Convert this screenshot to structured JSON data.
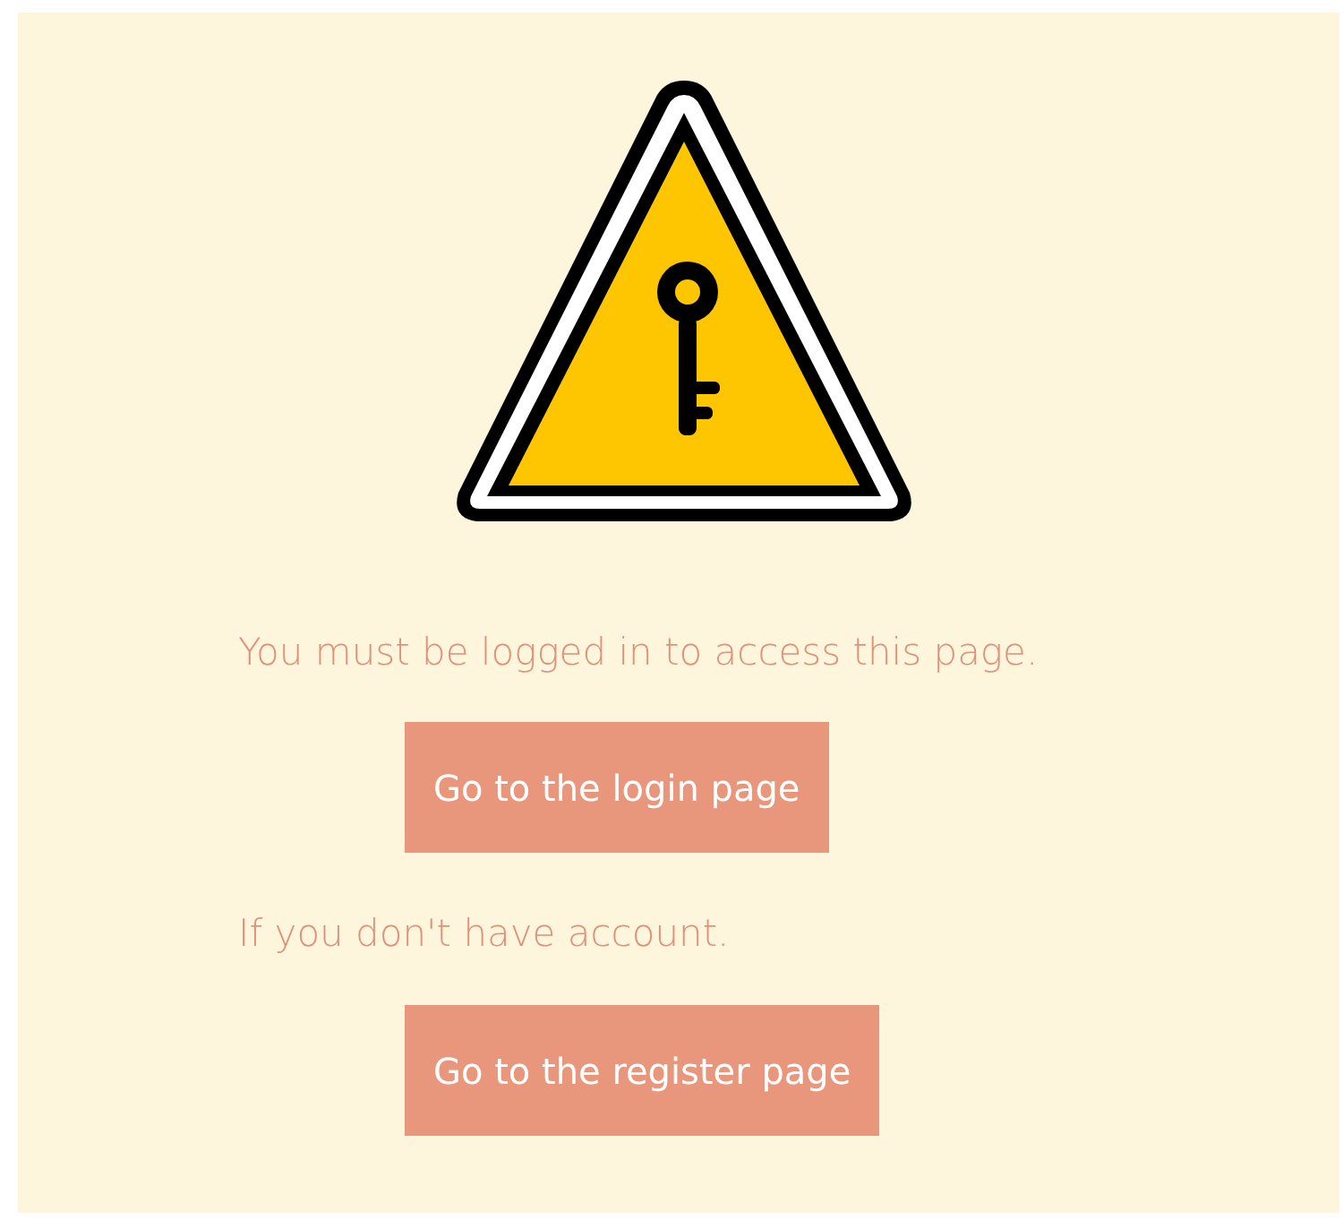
{
  "message": "You must be logged in to access this page.",
  "buttons": [
    {
      "label": "Go to the login page"
    },
    {
      "label": "Go to the register page"
    }
  ],
  "hint": "If you don't have account."
}
